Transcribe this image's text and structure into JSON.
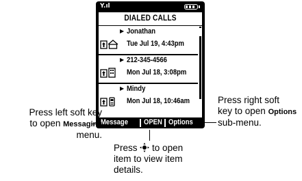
{
  "status": {
    "signal_glyph": "Y.ıl"
  },
  "screen": {
    "title": "DIALED CALLS",
    "entries": [
      {
        "name": "Jonathan",
        "date": "Tue Jul 19, 4:43pm",
        "icon": "home-icon"
      },
      {
        "name": "212-345-4566",
        "date": "Mon Jul 18, 3:08pm",
        "icon": "building-icon"
      },
      {
        "name": "Mindy",
        "date": "Mon Jul 18, 10:46am",
        "icon": "mobile-phone-icon"
      }
    ]
  },
  "softkeys": {
    "left": "Message",
    "center": "OPEN",
    "right": "Options"
  },
  "callouts": {
    "left": {
      "line1": "Press left soft key",
      "line2": "to open",
      "key": "Messaging",
      "line3": "menu."
    },
    "right": {
      "line1": "Press right soft",
      "line2": "key to open",
      "key": "Options",
      "line3": "sub-menu."
    },
    "center": {
      "line1_pre": "Press",
      "line1_post": "to open",
      "line2": "item to view item",
      "line3": "details."
    }
  }
}
